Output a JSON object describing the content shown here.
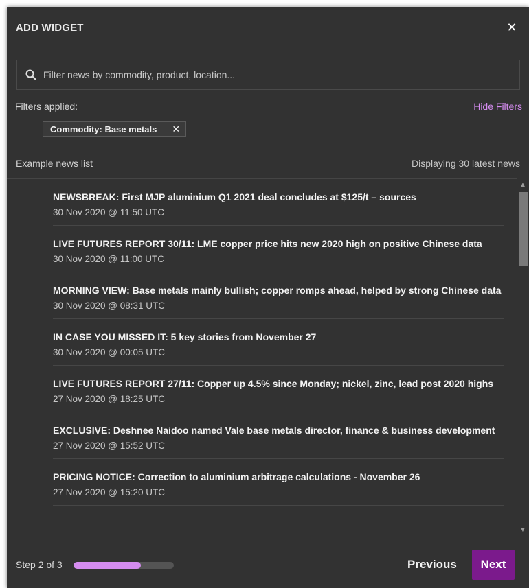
{
  "dialog": {
    "title": "ADD WIDGET",
    "close_icon": "close-icon"
  },
  "search": {
    "placeholder": "Filter news by commodity, product, location...",
    "value": "",
    "icon": "search-icon"
  },
  "filters": {
    "label": "Filters applied:",
    "hide_label": "Hide Filters",
    "chips": [
      {
        "label": "Commodity: Base metals",
        "remove_icon": "close-icon"
      }
    ]
  },
  "news": {
    "list_label": "Example news list",
    "count_label": "Displaying 30 latest news",
    "items": [
      {
        "headline": "NEWSBREAK: First MJP aluminium Q1 2021 deal concludes at $125/t – sources",
        "date": "30 Nov 2020 @ 11:50 UTC"
      },
      {
        "headline": "LIVE FUTURES REPORT 30/11: LME copper price hits new 2020 high on positive Chinese data",
        "date": "30 Nov 2020 @ 11:00 UTC"
      },
      {
        "headline": "MORNING VIEW: Base metals mainly bullish; copper romps ahead, helped by strong Chinese data",
        "date": "30 Nov 2020 @ 08:31 UTC"
      },
      {
        "headline": "IN CASE YOU MISSED IT: 5 key stories from November 27",
        "date": "30 Nov 2020 @ 00:05 UTC"
      },
      {
        "headline": "LIVE FUTURES REPORT 27/11: Copper up 4.5% since Monday; nickel, zinc, lead post 2020 highs",
        "date": "27 Nov 2020 @ 18:25 UTC"
      },
      {
        "headline": "EXCLUSIVE: Deshnee Naidoo named Vale base metals director, finance & business development",
        "date": "27 Nov 2020 @ 15:52 UTC"
      },
      {
        "headline": "PRICING NOTICE: Correction to aluminium arbitrage calculations - November 26",
        "date": "27 Nov 2020 @ 15:20 UTC"
      }
    ]
  },
  "footer": {
    "step_label": "Step 2 of 3",
    "progress_fraction": 0.67,
    "previous_label": "Previous",
    "next_label": "Next"
  },
  "colors": {
    "accent": "#d58cf0",
    "primary_button": "#7b1a8c",
    "panel": "#323232"
  }
}
